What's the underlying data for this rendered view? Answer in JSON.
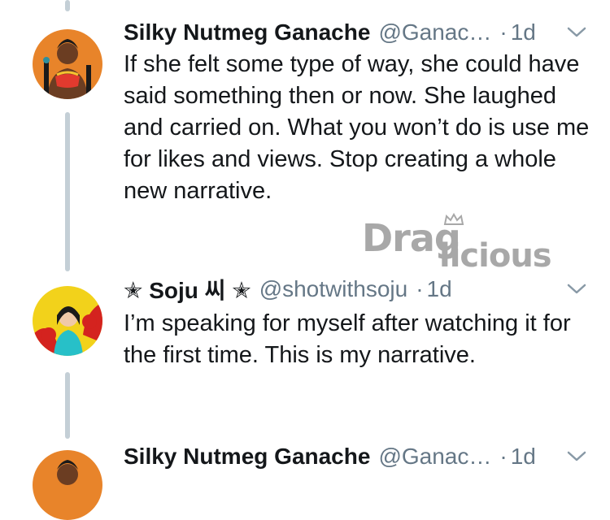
{
  "tweets": [
    {
      "display_name": "Silky Nutmeg Ganache",
      "handle": "@Ganac…",
      "separator": "·",
      "time": "1d",
      "text": "If she felt some type of way, she could have said something then or now. She laughed and carried on. What you won’t do is use me for likes and views. Stop creating a whole new narrative.",
      "avatar_icon": "avatar-silky-icon"
    },
    {
      "display_name": "✭ Soju 씨 ✭",
      "handle": "@shotwithsoju",
      "separator": "·",
      "time": "1d",
      "text": "I’m speaking for myself after watching it for the first time. This is my narrative.",
      "avatar_icon": "avatar-soju-icon"
    },
    {
      "display_name": "Silky Nutmeg Ganache",
      "handle": "@Ganac…",
      "separator": "·",
      "time": "1d",
      "text": "",
      "avatar_icon": "avatar-silky-icon"
    }
  ],
  "watermark": {
    "part1": "Drag",
    "part2": "licious",
    "color": "#a8a8a8"
  },
  "colors": {
    "text": "#14171a",
    "secondary": "#657786",
    "thread_line": "#c4cfd6",
    "background": "#ffffff"
  }
}
